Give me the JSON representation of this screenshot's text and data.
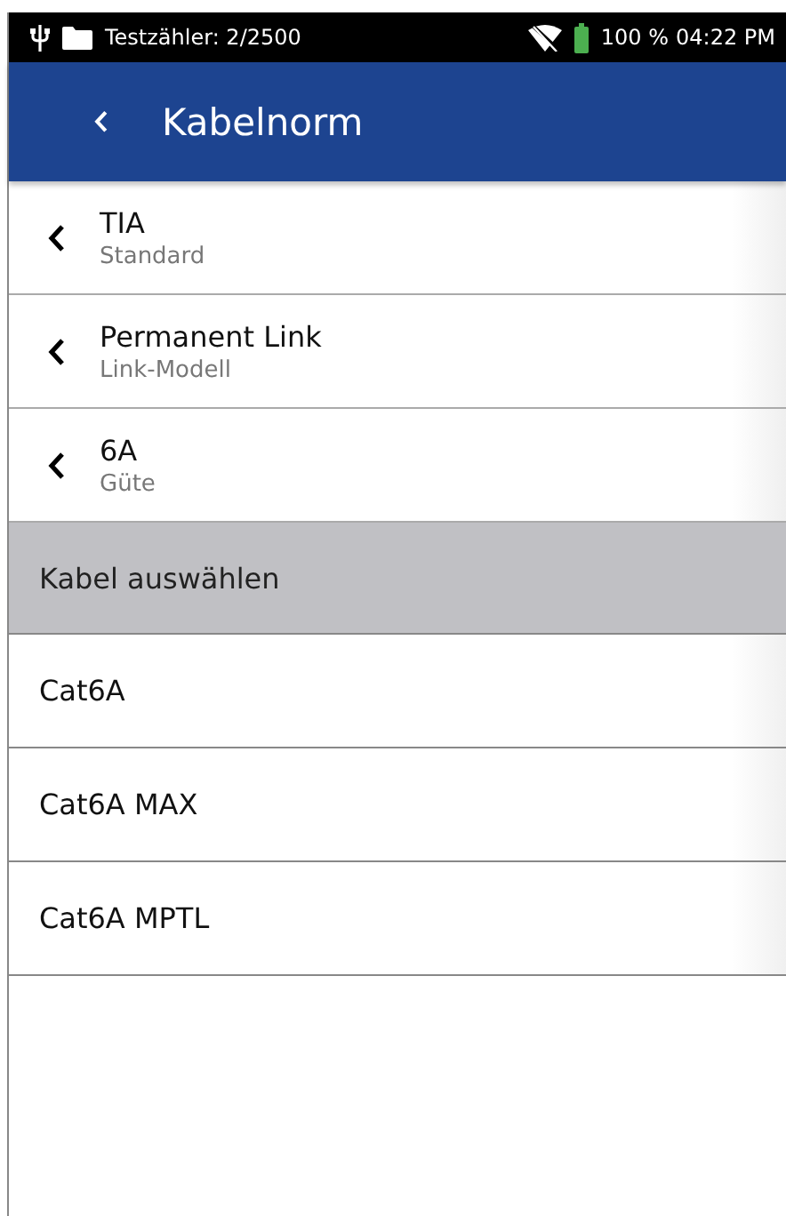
{
  "status_bar": {
    "counter": "Testzähler: 2/2500",
    "battery": "100 %",
    "time": "04:22 PM"
  },
  "header": {
    "title": "Kabelnorm"
  },
  "filters": [
    {
      "value": "TIA",
      "label": "Standard"
    },
    {
      "value": "Permanent Link",
      "label": "Link-Modell"
    },
    {
      "value": "6A",
      "label": "Güte"
    }
  ],
  "section": {
    "title": "Kabel auswählen"
  },
  "cables": [
    {
      "label": "Cat6A"
    },
    {
      "label": "Cat6A MAX"
    },
    {
      "label": "Cat6A MPTL"
    }
  ]
}
